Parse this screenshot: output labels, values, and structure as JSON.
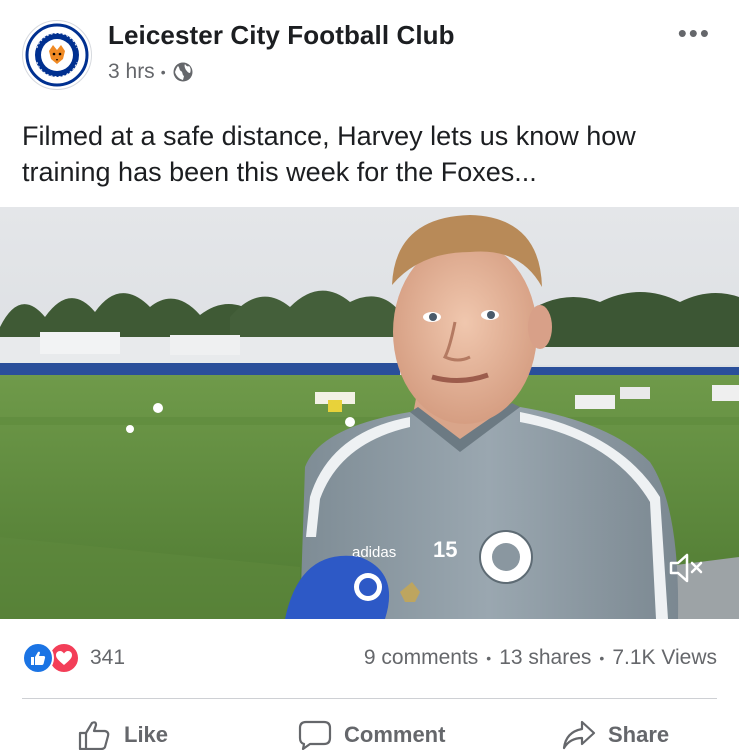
{
  "post": {
    "page_name": "Leicester City Football Club",
    "time": "3 hrs",
    "audience_icon": "globe-icon",
    "text": "Filmed at a safe distance, Harvey lets us know how training has been this week for the Foxes...",
    "more_icon": "more-icon"
  },
  "video": {
    "shirt_number": "15",
    "brand": "adidas",
    "mute_icon": "muted-speaker-icon"
  },
  "stats": {
    "reaction_count": "341",
    "comments": "9 comments",
    "shares": "13 shares",
    "views": "7.1K Views"
  },
  "actions": {
    "like": "Like",
    "comment": "Comment",
    "share": "Share"
  },
  "colors": {
    "like_blue": "#1b74e4",
    "love_red": "#f33e58",
    "meta_gray": "#65676b",
    "club_blue": "#003090"
  }
}
